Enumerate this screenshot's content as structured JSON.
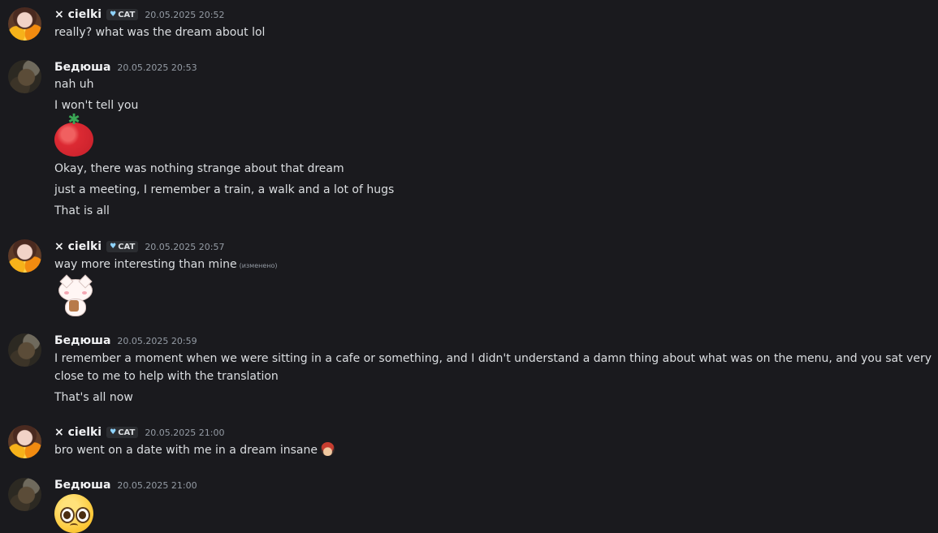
{
  "messages": [
    {
      "author": "× cielki",
      "tag": "CAT",
      "timestamp": "20.05.2025 20:52",
      "lines": [
        "really? what was the dream about lol"
      ]
    },
    {
      "author": "Бедюша",
      "timestamp": "20.05.2025 20:53",
      "lines": [
        "nah uh",
        "I won't tell you",
        "Okay, there was nothing strange about that dream",
        "just a meeting, I remember a train, a walk and a lot of hugs",
        "That is all"
      ],
      "emoji": "tomato-emoji"
    },
    {
      "author": "× cielki",
      "tag": "CAT",
      "timestamp": "20.05.2025 20:57",
      "lines": [
        "way more interesting than mine"
      ],
      "edited_label": "(изменено)",
      "sticker": "cat-boba-sticker"
    },
    {
      "author": "Бедюша",
      "timestamp": "20.05.2025 20:59",
      "lines": [
        "I remember a moment when we were sitting in a cafe or something, and I didn't understand a damn thing about what was on the menu, and you sat very close to me to help with the translation",
        "That's all now"
      ]
    },
    {
      "author": "× cielki",
      "tag": "CAT",
      "timestamp": "20.05.2025 21:00",
      "lines": [
        "bro went on a date with me in a dream insane"
      ],
      "inline_emoji": "custom-emoji"
    },
    {
      "author": "Бедюша",
      "timestamp": "20.05.2025 21:00",
      "emoji": "pleading-face-emoji"
    }
  ],
  "colors": {
    "background": "#1a1a1e",
    "text": "#dbdee1",
    "username": "#f2f3f5",
    "timestamp": "#949ba4",
    "tag_heart": "#8fd4ff"
  }
}
